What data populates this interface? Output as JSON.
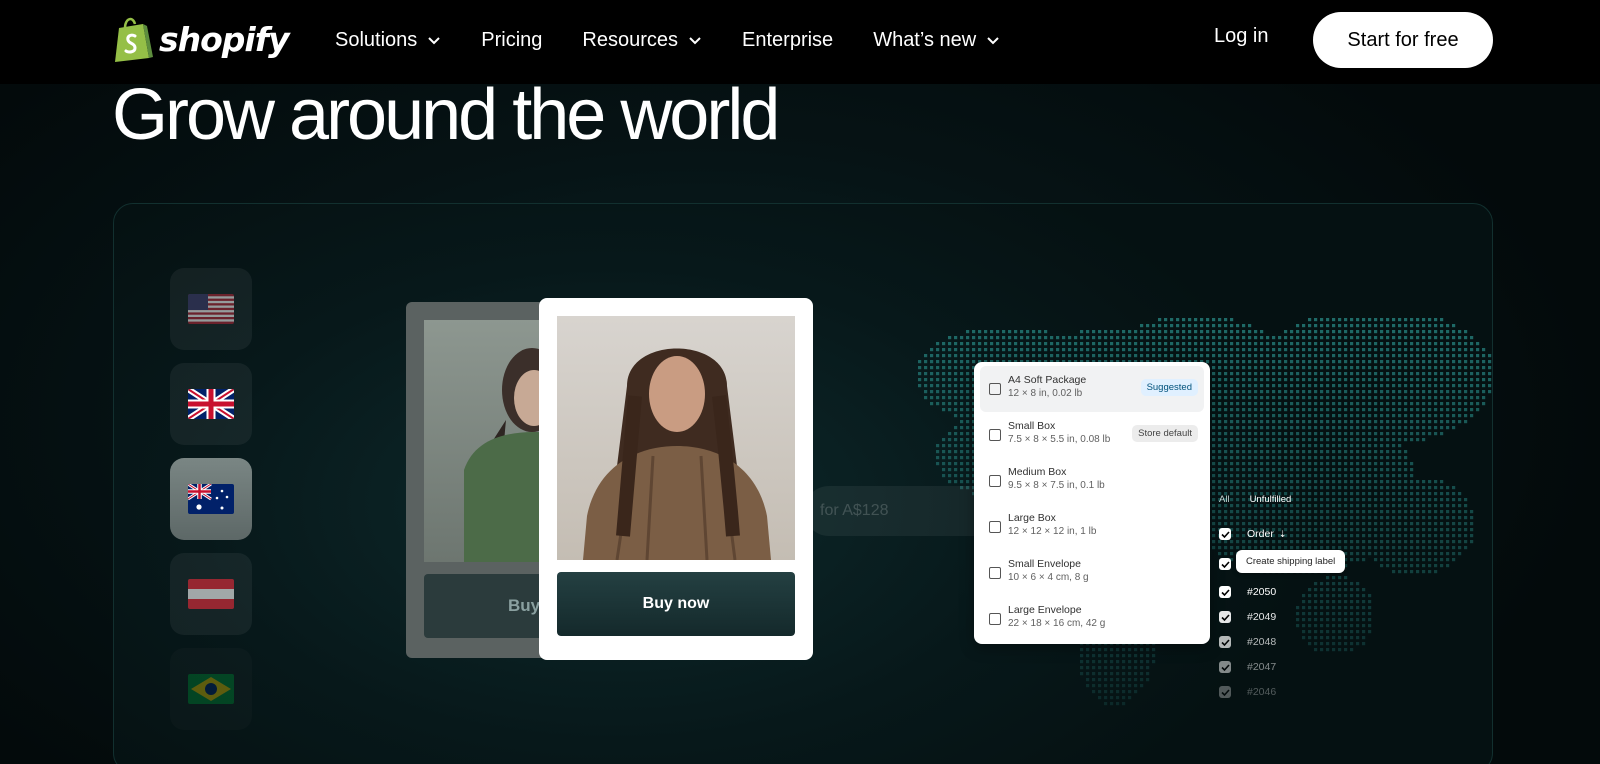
{
  "nav": {
    "brand": "shopify",
    "links": [
      {
        "label": "Solutions",
        "has_dropdown": true
      },
      {
        "label": "Pricing",
        "has_dropdown": false
      },
      {
        "label": "Resources",
        "has_dropdown": true
      },
      {
        "label": "Enterprise",
        "has_dropdown": false
      },
      {
        "label": "What’s new",
        "has_dropdown": true
      }
    ],
    "login_label": "Log in",
    "cta_label": "Start for free"
  },
  "hero": {
    "headline": "Grow around the world"
  },
  "flags": [
    "united-states",
    "united-kingdom",
    "australia",
    "austria",
    "brazil"
  ],
  "active_flag": "australia",
  "products": {
    "back_button_label": "Buy",
    "front_button_label": "Buy now",
    "ghost_price_label": "for A$128"
  },
  "packages": [
    {
      "name": "A4 Soft Package",
      "dims": "12 × 8 in, 0.02 lb",
      "badge": "Suggested",
      "selected": true
    },
    {
      "name": "Small Box",
      "dims": "7.5 × 8 × 5.5 in, 0.08 lb",
      "badge": "Store default",
      "selected": false
    },
    {
      "name": "Medium Box",
      "dims": "9.5 × 8 × 7.5 in, 0.1 lb",
      "badge": "",
      "selected": false
    },
    {
      "name": "Large Box",
      "dims": "12 × 12 × 12 in, 1 lb",
      "badge": "",
      "selected": false
    },
    {
      "name": "Small Envelope",
      "dims": "10 × 6 × 4 cm, 8 g",
      "badge": "",
      "selected": false
    },
    {
      "name": "Large Envelope",
      "dims": "22 × 18 × 16 cm, 42 g",
      "badge": "",
      "selected": false
    }
  ],
  "orders": {
    "tab_all": "All",
    "tab_unfulfilled": "Unfulfilled",
    "column_label": "Order",
    "action_label": "Create shipping label",
    "rows": [
      "#2050",
      "#2049",
      "#2048",
      "#2047",
      "#2046"
    ]
  },
  "colors": {
    "accent_green": "#95bf47",
    "badge_suggested_bg": "#e0f0ff",
    "map_dot": "#1f6b68",
    "button_dark": "#1c3436"
  }
}
